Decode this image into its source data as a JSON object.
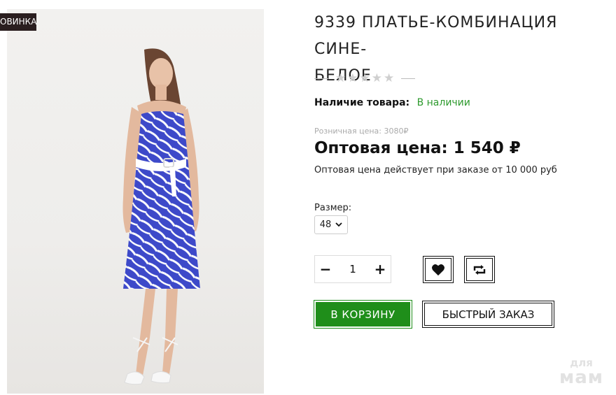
{
  "badge": "ОВИНКА",
  "product": {
    "title_line1": "9339 ПЛАТЬЕ-КОМБИНАЦИЯ СИНЕ-",
    "title_line2": "БЕЛОЕ",
    "rating_stars": 0,
    "rating_max": 5,
    "availability_label": "Наличие товара:",
    "availability_value": "В наличии",
    "retail_price": "Розничная цена: 3080₽",
    "wholesale_price": "Оптовая цена: 1 540 ₽",
    "wholesale_note": "Оптовая цена действует при заказе от 10 000 руб",
    "size_label": "Размер:",
    "size_value": "48",
    "quantity": "1"
  },
  "controls": {
    "minus": "−",
    "plus": "+",
    "wishlist_icon": "heart-icon",
    "compare_icon": "compare-icon",
    "cart_button": "В КОРЗИНУ",
    "quick_order_button": "БЫСТРЫЙ ЗАКАЗ"
  },
  "watermark": {
    "line1": "для",
    "line2": "мам"
  },
  "colors": {
    "accent_green": "#1f8e1a",
    "availability_green": "#2e9a2e",
    "badge_bg": "#2a1e1f"
  }
}
